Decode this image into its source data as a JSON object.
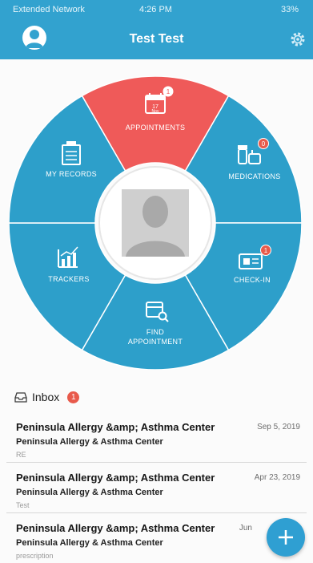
{
  "status_bar": {
    "carrier": "Extended Network",
    "time": "4:26 PM",
    "battery": "33%"
  },
  "header": {
    "title": "Test Test",
    "avatar_icon": "user-avatar-icon",
    "settings_icon": "gear-icon"
  },
  "menu": {
    "appointments": {
      "label": "APPOINTMENTS",
      "badge": "1",
      "calendar_month": "Nov",
      "calendar_day": "17",
      "icon": "calendar-icon"
    },
    "medications": {
      "label": "MEDICATIONS",
      "badge": "0",
      "icon": "pill-bottle-icon"
    },
    "check_in": {
      "label": "CHECK-IN",
      "badge": "1",
      "icon": "check-in-icon"
    },
    "find_appointment": {
      "label_line1": "FIND",
      "label_line2": "APPOINTMENT",
      "icon": "calendar-search-icon"
    },
    "trackers": {
      "label": "TRACKERS",
      "icon": "chart-icon"
    },
    "my_records": {
      "label": "MY RECORDS",
      "icon": "records-icon"
    }
  },
  "inbox": {
    "label": "Inbox",
    "badge": "1",
    "messages": [
      {
        "sender": "Peninsula Allergy &amp; Asthma Center",
        "org": "Peninsula Allergy & Asthma Center",
        "subject": "RE",
        "date": "Sep 5, 2019"
      },
      {
        "sender": "Peninsula Allergy &amp; Asthma Center",
        "org": "Peninsula Allergy & Asthma Center",
        "subject": "Test",
        "date": "Apr 23, 2019"
      },
      {
        "sender": "Peninsula Allergy &amp; Asthma Center",
        "org": "Peninsula Allergy & Asthma Center",
        "subject": "prescription",
        "date": "Jun"
      }
    ]
  },
  "colors": {
    "brand": "#32a2cf",
    "segment": "#2d9fca",
    "active_segment": "#ef5a59",
    "badge": "#e85a4b"
  }
}
